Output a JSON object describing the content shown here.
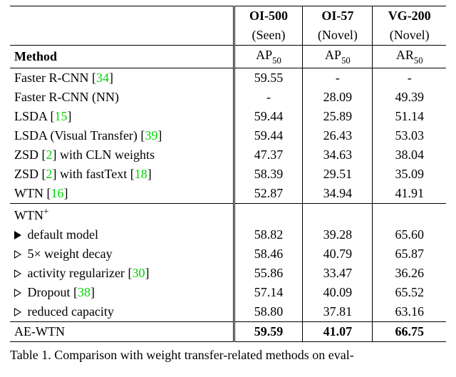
{
  "chart_data": {
    "type": "table",
    "title": "Table 1. Comparison with weight transfer-related methods on eval-",
    "columns": [
      {
        "dataset": "OI-500",
        "split": "Seen",
        "metric": "AP50"
      },
      {
        "dataset": "OI-57",
        "split": "Novel",
        "metric": "AP50"
      },
      {
        "dataset": "VG-200",
        "split": "Novel",
        "metric": "AR50"
      }
    ],
    "groups": [
      {
        "rows": [
          {
            "method": "Faster R-CNN",
            "ref": "34",
            "values": [
              59.55,
              null,
              null
            ]
          },
          {
            "method": "Faster R-CNN (NN)",
            "ref": null,
            "values": [
              null,
              28.09,
              49.39
            ]
          },
          {
            "method": "LSDA",
            "ref": "15",
            "values": [
              59.44,
              25.89,
              51.14
            ]
          },
          {
            "method": "LSDA (Visual Transfer)",
            "ref": "39",
            "values": [
              59.44,
              26.43,
              53.03
            ]
          },
          {
            "method": "ZSD with CLN weights",
            "ref": "2",
            "values": [
              47.37,
              34.63,
              38.04
            ]
          },
          {
            "method": "ZSD with fastText",
            "ref": "2",
            "ref2": "18",
            "values": [
              58.39,
              29.51,
              35.09
            ]
          },
          {
            "method": "WTN",
            "ref": "16",
            "values": [
              52.87,
              34.94,
              41.91
            ]
          }
        ]
      },
      {
        "header": "WTN+",
        "rows": [
          {
            "method": "default model",
            "marker": "filled",
            "values": [
              58.82,
              39.28,
              65.6
            ]
          },
          {
            "method": "5× weight decay",
            "marker": "open",
            "values": [
              58.46,
              40.79,
              65.87
            ]
          },
          {
            "method": "activity regularizer",
            "marker": "open",
            "ref": "30",
            "values": [
              55.86,
              33.47,
              36.26
            ]
          },
          {
            "method": "Dropout",
            "marker": "open",
            "ref": "38",
            "values": [
              57.14,
              40.09,
              65.52
            ]
          },
          {
            "method": "reduced capacity",
            "marker": "open",
            "values": [
              58.8,
              37.81,
              63.16
            ]
          }
        ]
      },
      {
        "rows": [
          {
            "method": "AE-WTN",
            "bold": true,
            "values": [
              59.59,
              41.07,
              66.75
            ]
          }
        ]
      }
    ]
  },
  "header": {
    "method_label": "Method",
    "ds1": "OI-500",
    "sp1": "(Seen)",
    "m1a": "AP",
    "m1b": "50",
    "ds2": "OI-57",
    "sp2": "(Novel)",
    "m2a": "AP",
    "m2b": "50",
    "ds3": "VG-200",
    "sp3": "(Novel)",
    "m3a": "AR",
    "m3b": "50"
  },
  "rows_g1": {
    "r0": {
      "m": "Faster R-CNN",
      "ref": "34",
      "c1": "59.55",
      "c2": "-",
      "c3": "-"
    },
    "r1": {
      "m": "Faster R-CNN (NN)",
      "c1": "-",
      "c2": "28.09",
      "c3": "49.39"
    },
    "r2": {
      "m": "LSDA",
      "ref": "15",
      "c1": "59.44",
      "c2": "25.89",
      "c3": "51.14"
    },
    "r3": {
      "m": "LSDA (Visual Transfer)",
      "ref": "39",
      "c1": "59.44",
      "c2": "26.43",
      "c3": "53.03"
    },
    "r4": {
      "m_a": "ZSD",
      "ref": "2",
      "m_b": " with CLN weights",
      "c1": "47.37",
      "c2": "34.63",
      "c3": "38.04"
    },
    "r5": {
      "m_a": "ZSD",
      "ref": "2",
      "m_b": " with fastText",
      "ref2": "18",
      "c1": "58.39",
      "c2": "29.51",
      "c3": "35.09"
    },
    "r6": {
      "m": "WTN",
      "ref": "16",
      "c1": "52.87",
      "c2": "34.94",
      "c3": "41.91"
    }
  },
  "g2_header": {
    "label_a": "WTN",
    "label_b": "+"
  },
  "rows_g2": {
    "r0": {
      "m": " default model",
      "c1": "58.82",
      "c2": "39.28",
      "c3": "65.60"
    },
    "r1": {
      "m_a": " 5",
      "mult": "×",
      "m_b": " weight decay",
      "c1": "58.46",
      "c2": "40.79",
      "c3": "65.87"
    },
    "r2": {
      "m": " activity regularizer",
      "ref": "30",
      "c1": "55.86",
      "c2": "33.47",
      "c3": "36.26"
    },
    "r3": {
      "m": " Dropout",
      "ref": "38",
      "c1": "57.14",
      "c2": "40.09",
      "c3": "65.52"
    },
    "r4": {
      "m": " reduced capacity",
      "c1": "58.80",
      "c2": "37.81",
      "c3": "63.16"
    }
  },
  "rows_g3": {
    "r0": {
      "m": "AE-WTN",
      "c1": "59.59",
      "c2": "41.07",
      "c3": "66.75"
    }
  },
  "caption": "Table 1. Comparison with weight transfer-related methods on eval-",
  "brackets": {
    "open": "[",
    "close": "]",
    "space": " "
  }
}
